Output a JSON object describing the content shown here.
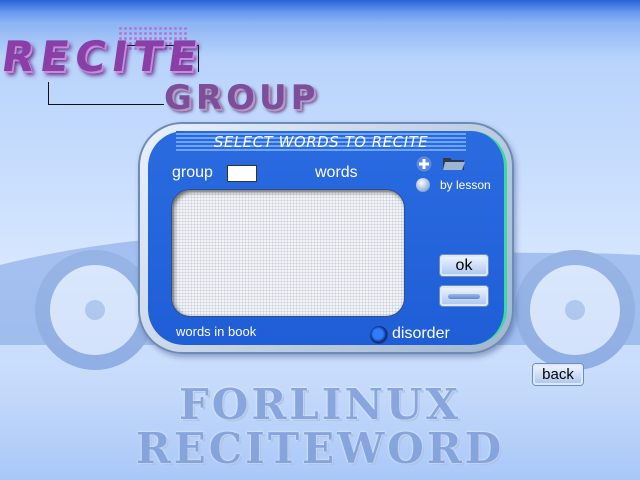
{
  "logo": {
    "line1": "RECITE",
    "line2": "GROUP"
  },
  "dialog": {
    "title": "SELECT WORDS TO RECITE",
    "group_label": "group",
    "group_value": "",
    "words_label": "words",
    "by_lesson_label": "by lesson",
    "words_in_book_label": "words in book",
    "disorder_label": "disorder",
    "ok_label": "ok",
    "blank_button_label": ""
  },
  "back_label": "back",
  "footer": {
    "line1": "FORLINUX",
    "line2": "RECITEWORD"
  },
  "icons": {
    "add": "plus-icon",
    "open": "folder-icon"
  },
  "colors": {
    "dialog_blue": "#2b6be0",
    "accent_green": "#3bd9a6",
    "logo_purple": "#8a3fa6"
  }
}
